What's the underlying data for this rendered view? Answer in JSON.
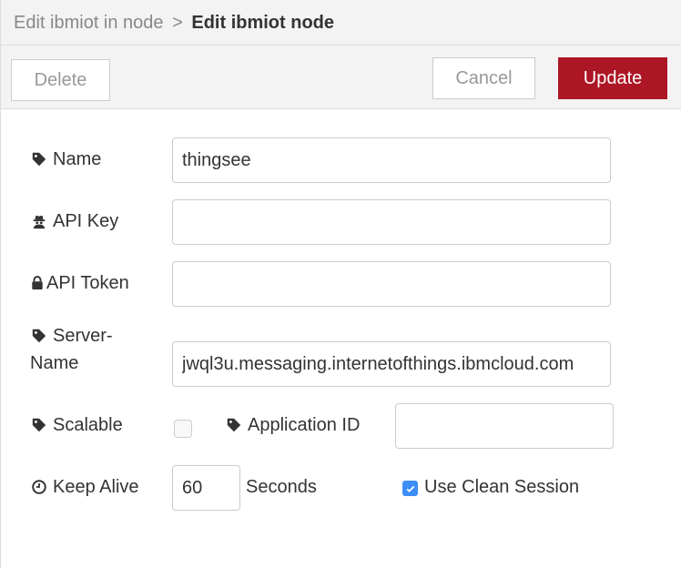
{
  "breadcrumb": {
    "parent": "Edit ibmiot in node",
    "separator": ">",
    "current": "Edit ibmiot node"
  },
  "toolbar": {
    "delete_label": "Delete",
    "cancel_label": "Cancel",
    "update_label": "Update"
  },
  "form": {
    "name": {
      "label": "Name",
      "value": "thingsee",
      "icon": "tag-icon"
    },
    "api_key": {
      "label": "API Key",
      "value": "",
      "icon": "user-secret-icon"
    },
    "api_token": {
      "label": "API Token",
      "value": "",
      "icon": "lock-icon"
    },
    "server_name": {
      "label_line1": "Server-",
      "label_line2": "Name",
      "value": "jwql3u.messaging.internetofthings.ibmcloud.com",
      "icon": "tag-icon"
    },
    "scalable": {
      "label": "Scalable",
      "checked": false,
      "icon": "tag-icon"
    },
    "application_id": {
      "label": "Application ID",
      "value": "",
      "icon": "tag-icon"
    },
    "keep_alive": {
      "label": "Keep Alive",
      "value": "60",
      "unit": "Seconds",
      "icon": "clock-icon"
    },
    "clean_session": {
      "label": "Use Clean Session",
      "checked": true
    }
  },
  "colors": {
    "update_button": "#ad1625",
    "checkbox_checked": "#3e8ef7"
  }
}
